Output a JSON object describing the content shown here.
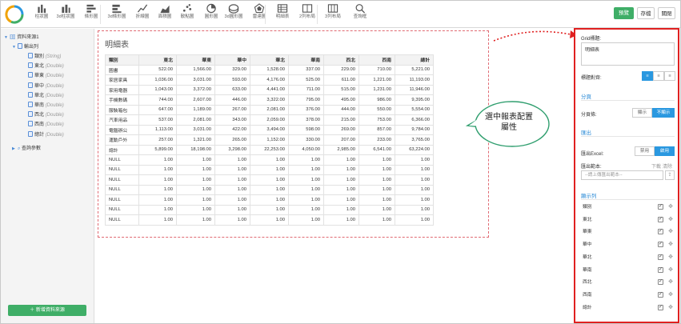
{
  "toolbar": {
    "tools": [
      {
        "label": "柱狀圖",
        "icon": "bar-chart-icon"
      },
      {
        "label": "3d柱狀圖",
        "icon": "3d-bar-chart-icon"
      },
      {
        "label": "條形圖",
        "icon": "horizontal-bar-chart-icon"
      },
      {
        "label": "3d條形圖",
        "icon": "3d-horizontal-bar-chart-icon"
      },
      {
        "label": "折線圖",
        "icon": "line-chart-icon"
      },
      {
        "label": "面積圖",
        "icon": "area-chart-icon"
      },
      {
        "label": "散點圖",
        "icon": "scatter-chart-icon"
      },
      {
        "label": "圓形圖",
        "icon": "pie-chart-icon"
      },
      {
        "label": "3d圓形圖",
        "icon": "3d-pie-chart-icon"
      },
      {
        "label": "雷達圖",
        "icon": "radar-chart-icon"
      },
      {
        "label": "明細表",
        "icon": "detail-table-icon"
      },
      {
        "label": "2列布局",
        "icon": "two-column-layout-icon"
      },
      {
        "label": "3列布局",
        "icon": "three-column-layout-icon"
      },
      {
        "label": "查詢框",
        "icon": "search-icon"
      }
    ],
    "preview": "預覽",
    "save": "存檔",
    "close": "關閉"
  },
  "sidebar": {
    "datasource": "資料來源1",
    "output": "輸出列",
    "fields": [
      {
        "name": "類別",
        "type": "(String)"
      },
      {
        "name": "東北",
        "type": "(Double)"
      },
      {
        "name": "華東",
        "type": "(Double)"
      },
      {
        "name": "華中",
        "type": "(Double)"
      },
      {
        "name": "華北",
        "type": "(Double)"
      },
      {
        "name": "華南",
        "type": "(Double)"
      },
      {
        "name": "西北",
        "type": "(Double)"
      },
      {
        "name": "西南",
        "type": "(Double)"
      },
      {
        "name": "總計",
        "type": "(Double)"
      }
    ],
    "query_params": "查詢參數",
    "add_button": "新增資料來源"
  },
  "report": {
    "title": "明細表",
    "headers": [
      "類別",
      "東北",
      "華東",
      "華中",
      "華北",
      "華南",
      "西北",
      "西南",
      "總計"
    ],
    "rows": [
      [
        "圖書",
        "522.00",
        "1,566.00",
        "329.00",
        "1,528.00",
        "337.00",
        "229.00",
        "710.00",
        "5,221.00"
      ],
      [
        "家居家具",
        "1,036.00",
        "3,031.00",
        "593.00",
        "4,176.00",
        "525.00",
        "611.00",
        "1,221.00",
        "11,193.00"
      ],
      [
        "家用電器",
        "1,043.00",
        "3,372.00",
        "633.00",
        "4,441.00",
        "711.00",
        "515.00",
        "1,231.00",
        "11,946.00"
      ],
      [
        "手機數碼",
        "744.00",
        "2,607.00",
        "446.00",
        "3,322.00",
        "795.00",
        "495.00",
        "986.00",
        "9,395.00"
      ],
      [
        "服裝箱包",
        "647.00",
        "1,189.00",
        "267.00",
        "2,081.00",
        "376.00",
        "444.00",
        "550.00",
        "5,554.00"
      ],
      [
        "汽車用品",
        "537.00",
        "2,081.00",
        "343.00",
        "2,059.00",
        "378.00",
        "215.00",
        "753.00",
        "6,366.00"
      ],
      [
        "電腦辦公",
        "1,113.00",
        "3,031.00",
        "422.00",
        "3,494.00",
        "598.00",
        "269.00",
        "857.00",
        "9,784.00"
      ],
      [
        "運動戶外",
        "257.00",
        "1,321.00",
        "265.00",
        "1,152.00",
        "330.00",
        "207.00",
        "233.00",
        "3,765.00"
      ],
      [
        "總計",
        "5,899.00",
        "18,198.00",
        "3,298.00",
        "22,253.00",
        "4,050.00",
        "2,985.00",
        "6,541.00",
        "63,224.00"
      ],
      [
        "NULL",
        "1.00",
        "1.00",
        "1.00",
        "1.00",
        "1.00",
        "1.00",
        "1.00",
        "1.00"
      ],
      [
        "NULL",
        "1.00",
        "1.00",
        "1.00",
        "1.00",
        "1.00",
        "1.00",
        "1.00",
        "1.00"
      ],
      [
        "NULL",
        "1.00",
        "1.00",
        "1.00",
        "1.00",
        "1.00",
        "1.00",
        "1.00",
        "1.00"
      ],
      [
        "NULL",
        "1.00",
        "1.00",
        "1.00",
        "1.00",
        "1.00",
        "1.00",
        "1.00",
        "1.00"
      ],
      [
        "NULL",
        "1.00",
        "1.00",
        "1.00",
        "1.00",
        "1.00",
        "1.00",
        "1.00",
        "1.00"
      ],
      [
        "NULL",
        "1.00",
        "1.00",
        "1.00",
        "1.00",
        "1.00",
        "1.00",
        "1.00",
        "1.00"
      ],
      [
        "NULL",
        "1.00",
        "1.00",
        "1.00",
        "1.00",
        "1.00",
        "1.00",
        "1.00",
        "1.00"
      ]
    ]
  },
  "callout": "選中報表配置屬性",
  "panel": {
    "grid_title_label": "Grid標題:",
    "grid_title_value": "明細表",
    "align_label": "標題對齊:",
    "paging_section": "分頁",
    "paging_label": "分頁條:",
    "paging_show": "顯示",
    "paging_hide": "不顯示",
    "export_section": "匯出",
    "excel_label": "匯出Excel:",
    "excel_disable": "禁用",
    "excel_enable": "啟用",
    "template_label": "匯出範本:",
    "download": "下載",
    "clear": "清除",
    "template_placeholder": "--請上傳匯出範本--",
    "columns_section": "顯示列",
    "columns": [
      "類別",
      "東北",
      "華東",
      "華中",
      "華北",
      "華南",
      "西北",
      "西南",
      "總計"
    ]
  }
}
